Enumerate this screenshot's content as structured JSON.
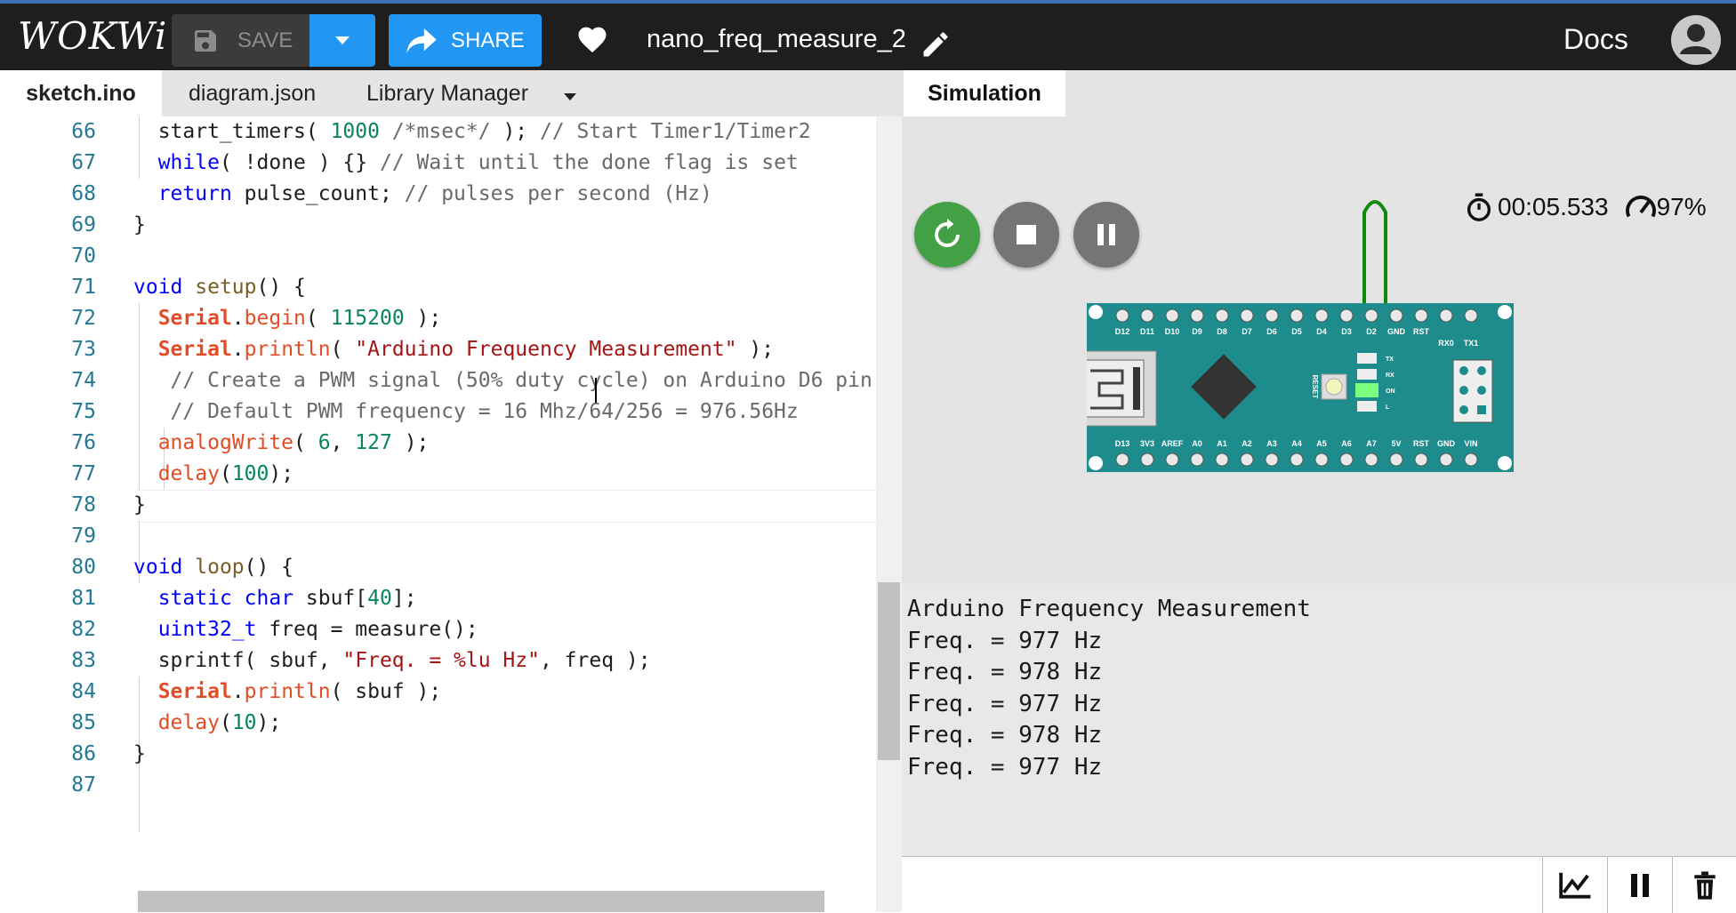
{
  "header": {
    "logo": "WOKWi",
    "save_label": "SAVE",
    "share_label": "SHARE",
    "project_name": "nano_freq_measure_2",
    "docs_label": "Docs"
  },
  "editor": {
    "tabs": [
      "sketch.ino",
      "diagram.json",
      "Library Manager"
    ],
    "active_tab": "sketch.ino",
    "line_numbers": [
      "66",
      "67",
      "68",
      "69",
      "70",
      "71",
      "72",
      "73",
      "74",
      "75",
      "76",
      "77",
      "78",
      "79",
      "80",
      "81",
      "82",
      "83",
      "84",
      "85",
      "86",
      "87"
    ],
    "lines": [
      "  start_timers( 1000 /*msec*/ ); // Start Timer1/Timer2",
      "  while( !done ) {} // Wait until the done flag is set",
      "  return pulse_count; // pulses per second (Hz)",
      "}",
      "",
      "void setup() {",
      "  Serial.begin( 115200 );",
      "  Serial.println( \"Arduino Frequency Measurement\" );",
      "   // Create a PWM signal (50% duty cycle) on Arduino D6 pin",
      "   // Default PWM frequency = 16 Mhz/64/256 = 976.56Hz",
      "  analogWrite( 6, 127 );",
      "  delay(100);",
      "}",
      "",
      "void loop() {",
      "  static char sbuf[40];",
      "  uint32_t freq = measure();",
      "  sprintf( sbuf, \"Freq. = %lu Hz\", freq );",
      "  Serial.println( sbuf );",
      "  delay(10);",
      "}",
      ""
    ],
    "current_line": "75"
  },
  "simulation": {
    "tab_label": "Simulation",
    "elapsed": "00:05.533",
    "speed": "97%",
    "board": {
      "top_pins": [
        "D12",
        "D11",
        "D10",
        "D9",
        "D8",
        "D7",
        "D6",
        "D5",
        "D4",
        "D3",
        "D2",
        "GND",
        "RST",
        "RX0",
        "TX1"
      ],
      "bottom_pins": [
        "D13",
        "3V3",
        "AREF",
        "A0",
        "A1",
        "A2",
        "A3",
        "A4",
        "A5",
        "A6",
        "A7",
        "5V",
        "RST",
        "GND",
        "VIN"
      ],
      "reset_label": "RESET",
      "led_labels": [
        "TX",
        "RX",
        "ON",
        "L"
      ]
    },
    "serial_output": [
      "Arduino Frequency Measurement",
      "Freq. = 977 Hz",
      "Freq. = 978 Hz",
      "Freq. = 977 Hz",
      "Freq. = 978 Hz",
      "Freq. = 977 Hz"
    ],
    "serial_input": ""
  },
  "colors": {
    "accent": "#2196f3",
    "restart": "#43a047",
    "board": "#1e8c8c",
    "wire": "#0f8a0f"
  }
}
